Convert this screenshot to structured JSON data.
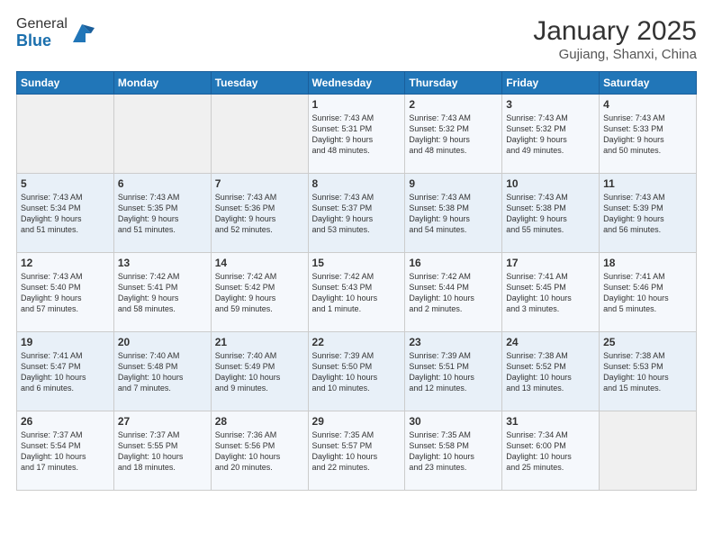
{
  "header": {
    "logo_general": "General",
    "logo_blue": "Blue",
    "month": "January 2025",
    "location": "Gujiang, Shanxi, China"
  },
  "days_of_week": [
    "Sunday",
    "Monday",
    "Tuesday",
    "Wednesday",
    "Thursday",
    "Friday",
    "Saturday"
  ],
  "weeks": [
    [
      {
        "day": "",
        "info": ""
      },
      {
        "day": "",
        "info": ""
      },
      {
        "day": "",
        "info": ""
      },
      {
        "day": "1",
        "info": "Sunrise: 7:43 AM\nSunset: 5:31 PM\nDaylight: 9 hours\nand 48 minutes."
      },
      {
        "day": "2",
        "info": "Sunrise: 7:43 AM\nSunset: 5:32 PM\nDaylight: 9 hours\nand 48 minutes."
      },
      {
        "day": "3",
        "info": "Sunrise: 7:43 AM\nSunset: 5:32 PM\nDaylight: 9 hours\nand 49 minutes."
      },
      {
        "day": "4",
        "info": "Sunrise: 7:43 AM\nSunset: 5:33 PM\nDaylight: 9 hours\nand 50 minutes."
      }
    ],
    [
      {
        "day": "5",
        "info": "Sunrise: 7:43 AM\nSunset: 5:34 PM\nDaylight: 9 hours\nand 51 minutes."
      },
      {
        "day": "6",
        "info": "Sunrise: 7:43 AM\nSunset: 5:35 PM\nDaylight: 9 hours\nand 51 minutes."
      },
      {
        "day": "7",
        "info": "Sunrise: 7:43 AM\nSunset: 5:36 PM\nDaylight: 9 hours\nand 52 minutes."
      },
      {
        "day": "8",
        "info": "Sunrise: 7:43 AM\nSunset: 5:37 PM\nDaylight: 9 hours\nand 53 minutes."
      },
      {
        "day": "9",
        "info": "Sunrise: 7:43 AM\nSunset: 5:38 PM\nDaylight: 9 hours\nand 54 minutes."
      },
      {
        "day": "10",
        "info": "Sunrise: 7:43 AM\nSunset: 5:38 PM\nDaylight: 9 hours\nand 55 minutes."
      },
      {
        "day": "11",
        "info": "Sunrise: 7:43 AM\nSunset: 5:39 PM\nDaylight: 9 hours\nand 56 minutes."
      }
    ],
    [
      {
        "day": "12",
        "info": "Sunrise: 7:43 AM\nSunset: 5:40 PM\nDaylight: 9 hours\nand 57 minutes."
      },
      {
        "day": "13",
        "info": "Sunrise: 7:42 AM\nSunset: 5:41 PM\nDaylight: 9 hours\nand 58 minutes."
      },
      {
        "day": "14",
        "info": "Sunrise: 7:42 AM\nSunset: 5:42 PM\nDaylight: 9 hours\nand 59 minutes."
      },
      {
        "day": "15",
        "info": "Sunrise: 7:42 AM\nSunset: 5:43 PM\nDaylight: 10 hours\nand 1 minute."
      },
      {
        "day": "16",
        "info": "Sunrise: 7:42 AM\nSunset: 5:44 PM\nDaylight: 10 hours\nand 2 minutes."
      },
      {
        "day": "17",
        "info": "Sunrise: 7:41 AM\nSunset: 5:45 PM\nDaylight: 10 hours\nand 3 minutes."
      },
      {
        "day": "18",
        "info": "Sunrise: 7:41 AM\nSunset: 5:46 PM\nDaylight: 10 hours\nand 5 minutes."
      }
    ],
    [
      {
        "day": "19",
        "info": "Sunrise: 7:41 AM\nSunset: 5:47 PM\nDaylight: 10 hours\nand 6 minutes."
      },
      {
        "day": "20",
        "info": "Sunrise: 7:40 AM\nSunset: 5:48 PM\nDaylight: 10 hours\nand 7 minutes."
      },
      {
        "day": "21",
        "info": "Sunrise: 7:40 AM\nSunset: 5:49 PM\nDaylight: 10 hours\nand 9 minutes."
      },
      {
        "day": "22",
        "info": "Sunrise: 7:39 AM\nSunset: 5:50 PM\nDaylight: 10 hours\nand 10 minutes."
      },
      {
        "day": "23",
        "info": "Sunrise: 7:39 AM\nSunset: 5:51 PM\nDaylight: 10 hours\nand 12 minutes."
      },
      {
        "day": "24",
        "info": "Sunrise: 7:38 AM\nSunset: 5:52 PM\nDaylight: 10 hours\nand 13 minutes."
      },
      {
        "day": "25",
        "info": "Sunrise: 7:38 AM\nSunset: 5:53 PM\nDaylight: 10 hours\nand 15 minutes."
      }
    ],
    [
      {
        "day": "26",
        "info": "Sunrise: 7:37 AM\nSunset: 5:54 PM\nDaylight: 10 hours\nand 17 minutes."
      },
      {
        "day": "27",
        "info": "Sunrise: 7:37 AM\nSunset: 5:55 PM\nDaylight: 10 hours\nand 18 minutes."
      },
      {
        "day": "28",
        "info": "Sunrise: 7:36 AM\nSunset: 5:56 PM\nDaylight: 10 hours\nand 20 minutes."
      },
      {
        "day": "29",
        "info": "Sunrise: 7:35 AM\nSunset: 5:57 PM\nDaylight: 10 hours\nand 22 minutes."
      },
      {
        "day": "30",
        "info": "Sunrise: 7:35 AM\nSunset: 5:58 PM\nDaylight: 10 hours\nand 23 minutes."
      },
      {
        "day": "31",
        "info": "Sunrise: 7:34 AM\nSunset: 6:00 PM\nDaylight: 10 hours\nand 25 minutes."
      },
      {
        "day": "",
        "info": ""
      }
    ]
  ]
}
